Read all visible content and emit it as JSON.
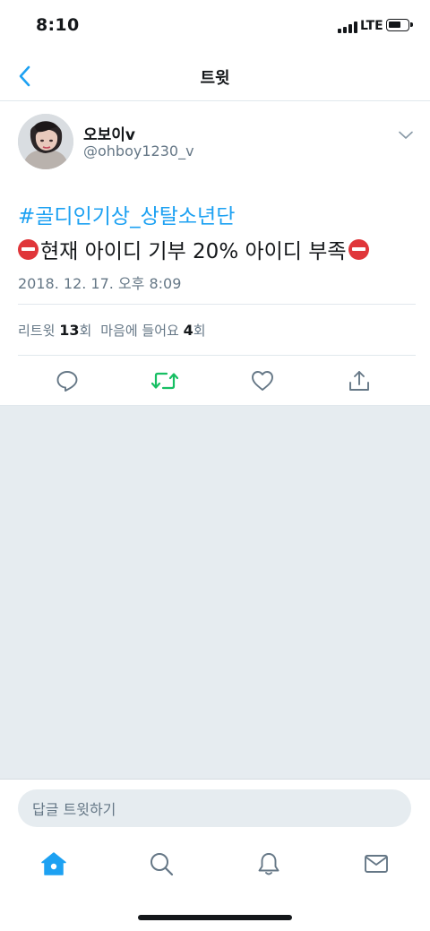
{
  "status_bar": {
    "time": "8:10",
    "network": "LTE"
  },
  "nav": {
    "title": "트윗",
    "back_icon": "chevron-left-icon"
  },
  "tweet": {
    "display_name": "오보이v",
    "handle": "@ohboy1230_v",
    "hashtag": "#골디인기상_상탈소년단",
    "text": "현재 아이디 기부 20% 아이디 부족",
    "text_emoji": "no-entry-icon",
    "timestamp": "2018. 12. 17. 오후 8:09",
    "stats": {
      "retweets_label": "리트윗",
      "retweets_count": "13",
      "retweets_suffix": "회",
      "likes_label": "마음에 들어요",
      "likes_count": "4",
      "likes_suffix": "회"
    },
    "actions": [
      "reply-icon",
      "retweet-icon",
      "heart-icon",
      "share-icon"
    ]
  },
  "reply": {
    "placeholder": "답글 트윗하기"
  },
  "tabs": [
    "home-icon",
    "search-icon",
    "bell-icon",
    "mail-icon"
  ],
  "colors": {
    "accent": "#1da1f2",
    "retweet": "#17bf63",
    "secondary_text": "#657786",
    "background_gray": "#e6ecf0"
  }
}
